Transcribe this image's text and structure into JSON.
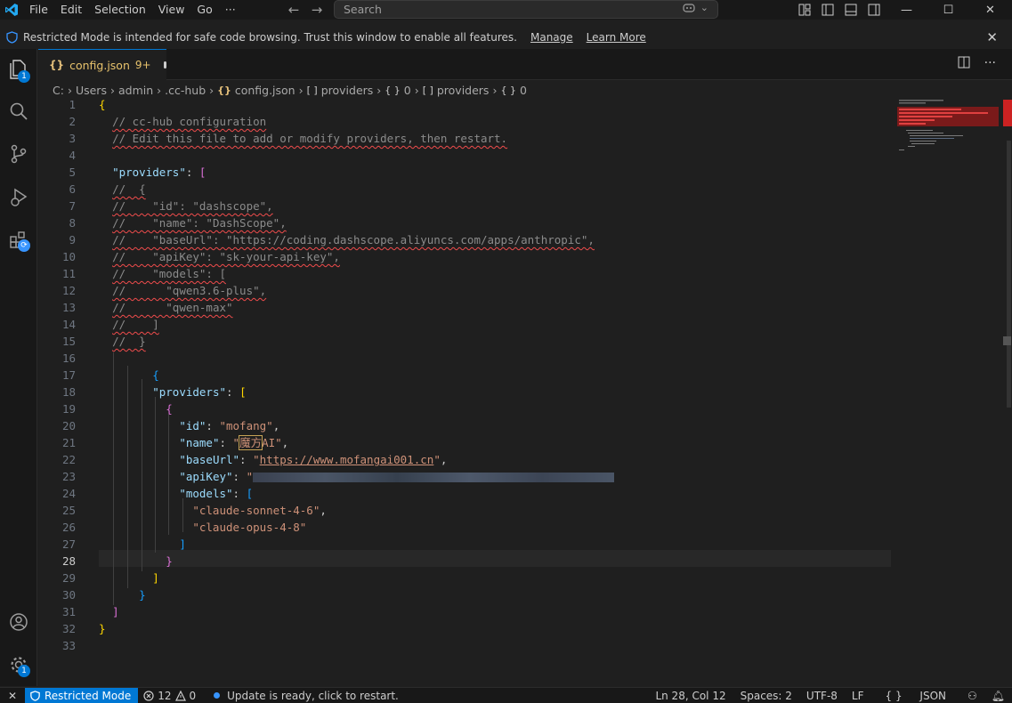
{
  "menu": [
    "File",
    "Edit",
    "Selection",
    "View",
    "Go",
    "···"
  ],
  "search": {
    "placeholder": "Search"
  },
  "banner": {
    "message": "Restricted Mode is intended for safe code browsing. Trust this window to enable all features.",
    "manage": "Manage",
    "learn_more": "Learn More"
  },
  "activity": {
    "explorer_badge": "1",
    "settings_badge": "1"
  },
  "tab": {
    "name": "config.json",
    "problems": "9+"
  },
  "breadcrumb": [
    "C:",
    "Users",
    "admin",
    ".cc-hub",
    "config.json",
    "providers",
    "0",
    "providers",
    "0"
  ],
  "editor": {
    "line_numbers": [
      "1",
      "2",
      "3",
      "4",
      "5",
      "6",
      "7",
      "8",
      "9",
      "10",
      "11",
      "12",
      "13",
      "14",
      "15",
      "16",
      "17",
      "18",
      "19",
      "20",
      "21",
      "22",
      "23",
      "24",
      "25",
      "26",
      "27",
      "28",
      "29",
      "30",
      "31",
      "32",
      "33"
    ],
    "current_line": 28,
    "lines": {
      "l2": "// cc-hub configuration",
      "l3": "// Edit this file to add or modify providers, then restart.",
      "l5_key": "\"providers\"",
      "l6": "//  {",
      "l7": "//    \"id\": \"dashscope\",",
      "l8": "//    \"name\": \"DashScope\",",
      "l9": "//    \"baseUrl\": \"https://coding.dashscope.aliyuncs.com/apps/anthropic\",",
      "l10": "//    \"apiKey\": \"sk-your-api-key\",",
      "l11": "//    \"models\": [",
      "l12": "//      \"qwen3.6-plus\",",
      "l13": "//      \"qwen-max\"",
      "l14": "//    ]",
      "l15": "//  }",
      "l18_key": "\"providers\"",
      "l20_key": "\"id\"",
      "l20_val": "\"mofang\"",
      "l21_key": "\"name\"",
      "l21_val_cn": "魔方",
      "l21_val_rest": "AI\"",
      "l22_key": "\"baseUrl\"",
      "l22_url": "https://www.mofangai001.cn",
      "l23_key": "\"apiKey\"",
      "l24_key": "\"models\"",
      "l25_val": "\"claude-sonnet-4-6\"",
      "l26_val": "\"claude-opus-4-8\""
    }
  },
  "status": {
    "restricted": "Restricted Mode",
    "errors": "12",
    "warnings": "0",
    "update": "Update is ready, click to restart.",
    "position": "Ln 28, Col 12",
    "spaces": "Spaces: 2",
    "encoding": "UTF-8",
    "eol": "LF",
    "language": "JSON"
  },
  "colors": {
    "accent": "#0078d4",
    "background": "#1f1f1f",
    "sidebar": "#181818"
  }
}
